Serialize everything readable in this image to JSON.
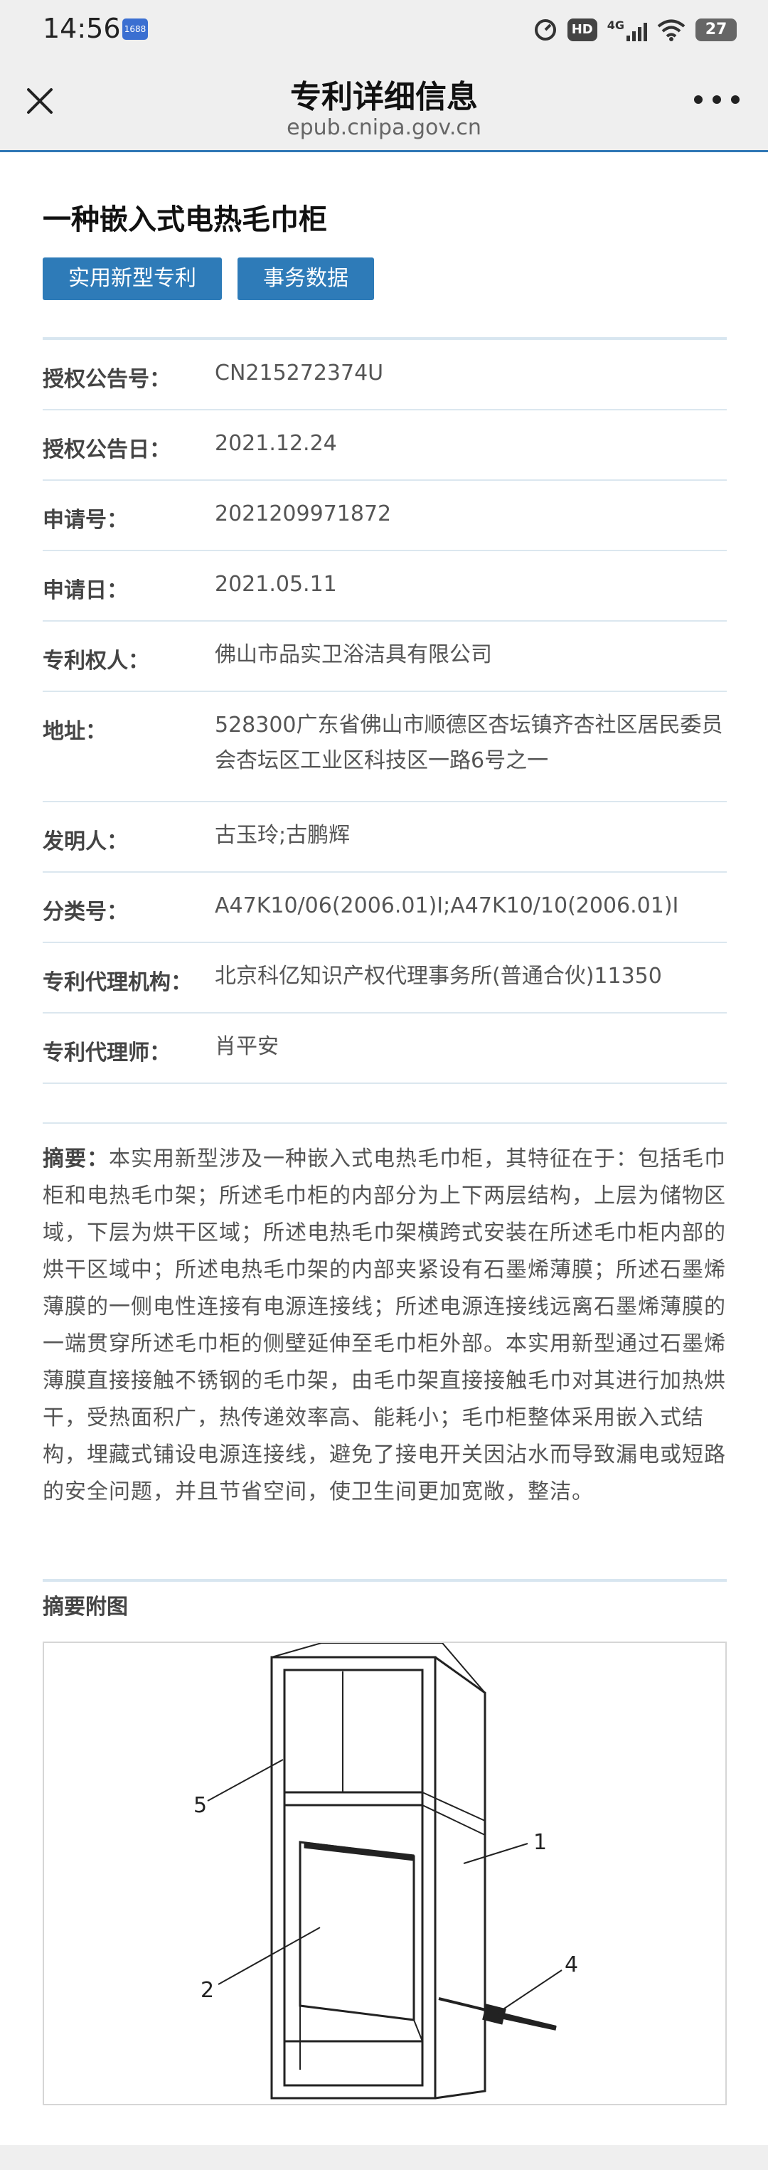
{
  "status_bar": {
    "time": "14:56",
    "app_badge": "1688",
    "hd": "HD",
    "network": "4G",
    "battery": "27"
  },
  "header": {
    "title": "专利详细信息",
    "subtitle": "epub.cnipa.gov.cn"
  },
  "patent": {
    "title": "一种嵌入式电热毛巾柜",
    "buttons": [
      "实用新型专利",
      "事务数据"
    ],
    "fields": [
      {
        "label": "授权公告号：",
        "value": "CN215272374U"
      },
      {
        "label": "授权公告日：",
        "value": "2021.12.24"
      },
      {
        "label": "申请号：",
        "value": "2021209971872"
      },
      {
        "label": "申请日：",
        "value": "2021.05.11"
      },
      {
        "label": "专利权人：",
        "value": "佛山市品实卫浴洁具有限公司"
      },
      {
        "label": "地址：",
        "value": "528300广东省佛山市顺德区杏坛镇齐杏社区居民委员会杏坛区工业区科技区一路6号之一"
      },
      {
        "label": "发明人：",
        "value": "古玉玲;古鹏辉"
      },
      {
        "label": "分类号：",
        "value": "A47K10/06(2006.01)I;A47K10/10(2006.01)I"
      },
      {
        "label": "专利代理机构：",
        "value": "北京科亿知识产权代理事务所(普通合伙)11350"
      },
      {
        "label": "专利代理师：",
        "value": "肖平安"
      }
    ],
    "abstract_label": "摘要：",
    "abstract_text": "本实用新型涉及一种嵌入式电热毛巾柜，其特征在于：包括毛巾柜和电热毛巾架；所述毛巾柜的内部分为上下两层结构，上层为储物区域，下层为烘干区域；所述电热毛巾架横跨式安装在所述毛巾柜内部的烘干区域中；所述电热毛巾架的内部夹紧设有石墨烯薄膜；所述石墨烯薄膜的一侧电性连接有电源连接线；所述电源连接线远离石墨烯薄膜的一端贯穿所述毛巾柜的侧壁延伸至毛巾柜外部。本实用新型通过石墨烯薄膜直接接触不锈钢的毛巾架，由毛巾架直接接触毛巾对其进行加热烘干，受热面积广，热传递效率高、能耗小；毛巾柜整体采用嵌入式结构，埋藏式铺设电源连接线，避免了接电开关因沾水而导致漏电或短路的安全问题，并且节省空间，使卫生间更加宽敞，整洁。",
    "figure_title": "摘要附图",
    "figure_labels": [
      "5",
      "1",
      "2",
      "4"
    ]
  }
}
